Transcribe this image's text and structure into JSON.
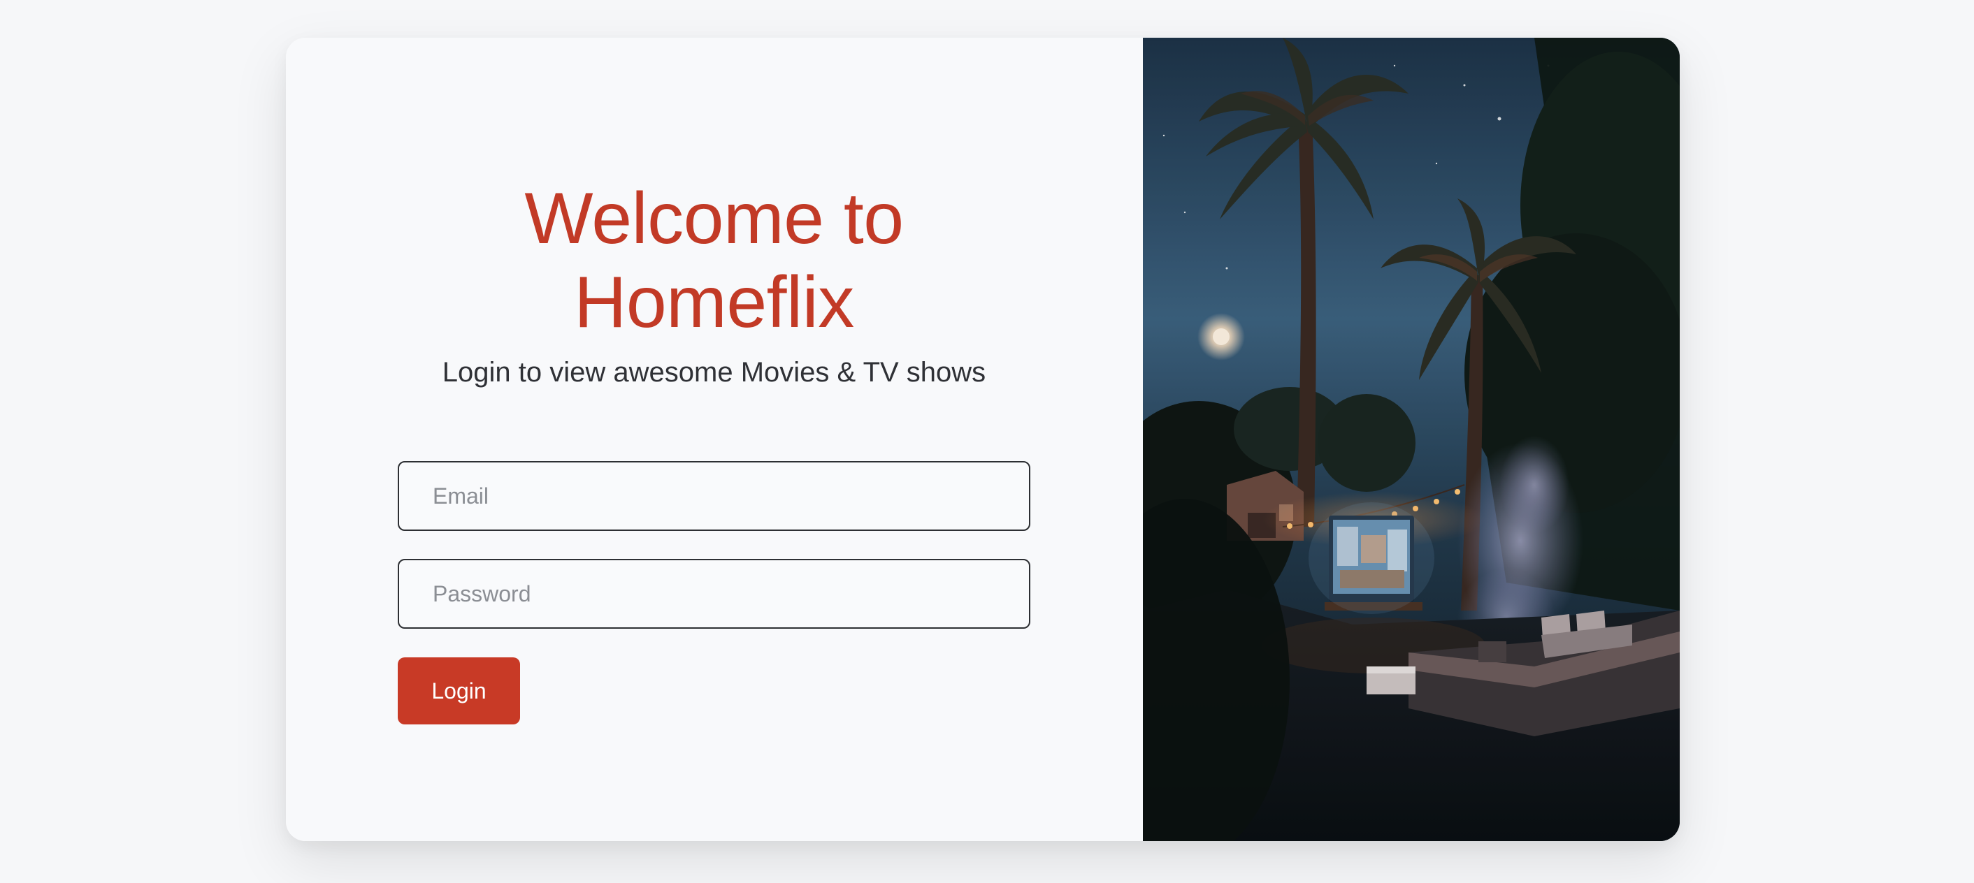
{
  "login": {
    "title": "Welcome to Homeflix",
    "subtitle": "Login to view awesome Movies & TV shows",
    "email_placeholder": "Email",
    "password_placeholder": "Password",
    "login_label": "Login"
  },
  "colors": {
    "brand": "#c83a26",
    "title": "#c23a26",
    "page_bg": "#f6f7f9",
    "text": "#2f3136"
  },
  "hero_image": {
    "icon": "backyard-movie-night-photo"
  }
}
